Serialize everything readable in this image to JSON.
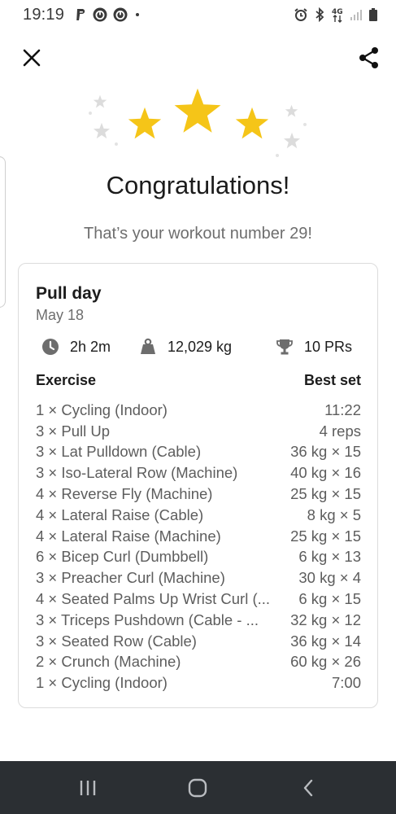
{
  "status_bar": {
    "time": "19:19",
    "left_icons": [
      "paypal-icon",
      "alarm-app-icon",
      "alarm-app-icon",
      "notification-dot-icon"
    ],
    "right_icons": [
      "alarm-clock-icon",
      "bluetooth-icon",
      "network-4g-icon",
      "signal-icon",
      "battery-icon"
    ],
    "network_label": "4G"
  },
  "header": {
    "close_icon": "close-icon",
    "share_icon": "share-icon"
  },
  "celebration": {
    "title": "Congratulations!",
    "subtitle": "That’s your workout number 29!",
    "star_color": "#f5c518",
    "sparkle_color": "#dedede"
  },
  "workout": {
    "name": "Pull day",
    "date": "May 18",
    "stats": {
      "duration": "2h 2m",
      "volume": "12,029 kg",
      "prs": "10 PRs"
    },
    "columns": {
      "exercise": "Exercise",
      "best_set": "Best set"
    },
    "exercises": [
      {
        "name": "1 × Cycling (Indoor)",
        "best": "11:22"
      },
      {
        "name": "3 × Pull Up",
        "best": "4 reps"
      },
      {
        "name": "3 × Lat Pulldown (Cable)",
        "best": "36 kg × 15"
      },
      {
        "name": "3 × Iso-Lateral Row (Machine)",
        "best": "40 kg × 16"
      },
      {
        "name": "4 × Reverse Fly (Machine)",
        "best": "25 kg × 15"
      },
      {
        "name": "4 × Lateral Raise (Cable)",
        "best": "8 kg × 5"
      },
      {
        "name": "4 × Lateral Raise (Machine)",
        "best": "25 kg × 15"
      },
      {
        "name": "6 × Bicep Curl (Dumbbell)",
        "best": "6 kg × 13"
      },
      {
        "name": "3 × Preacher Curl (Machine)",
        "best": "30 kg × 4"
      },
      {
        "name": "4 × Seated Palms Up Wrist Curl (...",
        "best": "6 kg × 15"
      },
      {
        "name": "3 × Triceps Pushdown (Cable - ...",
        "best": "32 kg × 12"
      },
      {
        "name": "3 × Seated Row (Cable)",
        "best": "36 kg × 14"
      },
      {
        "name": "2 × Crunch (Machine)",
        "best": "60 kg × 26"
      },
      {
        "name": "1 × Cycling (Indoor)",
        "best": "7:00"
      }
    ]
  },
  "nav_bar": {
    "buttons": [
      "recent-apps-icon",
      "home-icon",
      "back-icon"
    ],
    "background": "#2b2f33"
  }
}
